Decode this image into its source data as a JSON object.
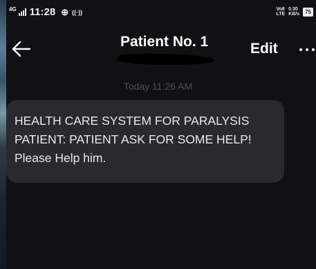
{
  "status_bar": {
    "network": "4G",
    "time": "11:28",
    "speed_value": "0.30",
    "speed_unit": "KB/s",
    "volte": "Vo8",
    "lte": "LTE",
    "battery": "75"
  },
  "header": {
    "title": "Patient No. 1",
    "edit_label": "Edit"
  },
  "conversation": {
    "timestamp": "Today 11:26 AM",
    "messages": [
      {
        "text": "HEALTH CARE SYSTEM FOR PARALYSIS PATIENT: PATIENT ASK FOR SOME HELP! Please Help him."
      }
    ]
  },
  "colors": {
    "background": "#111114",
    "bubble": "#2a2a2e",
    "text": "#e9e9eb",
    "timestamp": "#4d4d52"
  }
}
